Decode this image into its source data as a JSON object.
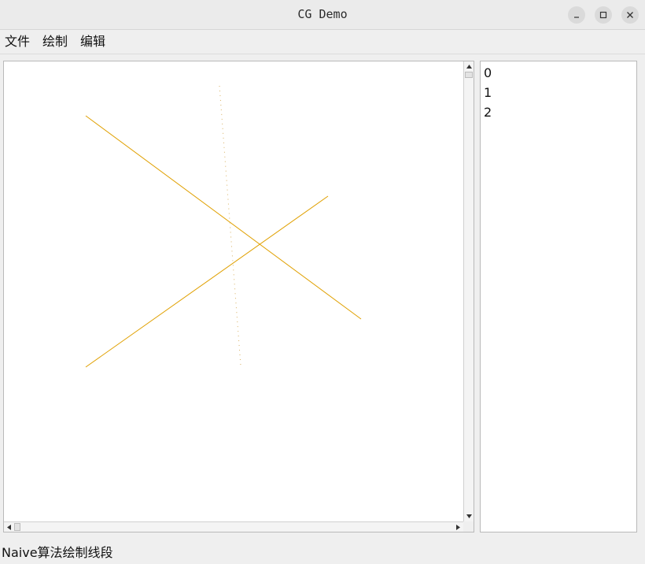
{
  "window": {
    "title": "CG Demo",
    "buttons": {
      "minimize_icon": "minimize-icon",
      "maximize_icon": "maximize-icon",
      "close_icon": "close-icon"
    }
  },
  "menubar": {
    "items": [
      {
        "label": "文件"
      },
      {
        "label": "绘制"
      },
      {
        "label": "编辑"
      }
    ]
  },
  "canvas": {
    "line_color": "#e0a000",
    "background": "#ffffff"
  },
  "item_list": {
    "items": [
      "0",
      "1",
      "2"
    ]
  },
  "statusbar": {
    "text": "Naive算法绘制线段"
  }
}
